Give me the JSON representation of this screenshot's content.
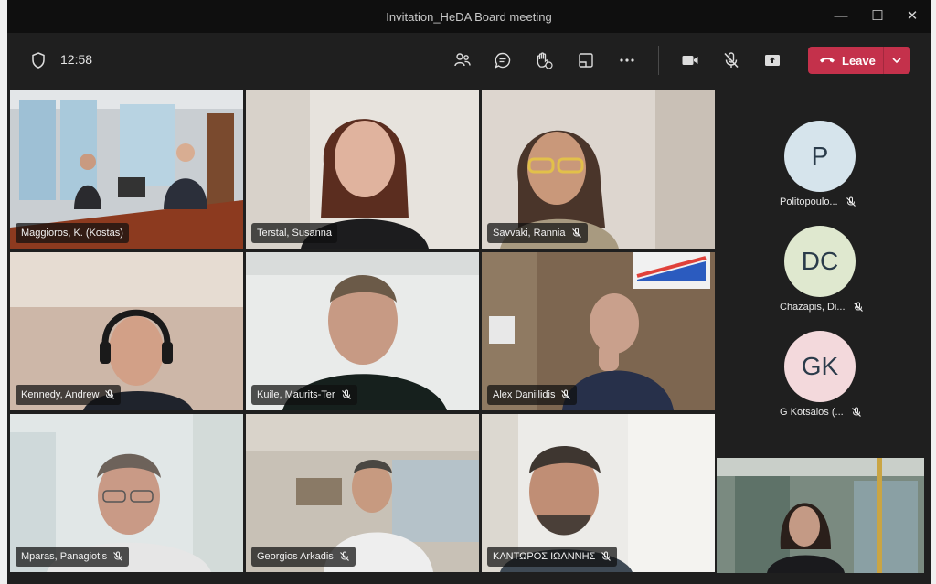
{
  "window": {
    "title": "Invitation_HeDA Board meeting"
  },
  "toolbar": {
    "timer": "12:58",
    "leave_label": "Leave",
    "icons": [
      "shield-icon",
      "people-icon",
      "chat-icon",
      "raise-hand-icon",
      "rooms-icon",
      "more-icon",
      "camera-icon",
      "mic-muted-icon",
      "share-icon"
    ]
  },
  "colors": {
    "leave": "#c4314b",
    "active_border": "#9ea2ff",
    "bg": "#1f1f1f",
    "titlebar": "#0f0f0f"
  },
  "participants": [
    {
      "name": "Maggioros, K. (Kostas)",
      "muted": false,
      "active": true
    },
    {
      "name": "Terstal, Susanna",
      "muted": false
    },
    {
      "name": "Savvaki, Rannia",
      "muted": true
    },
    {
      "name": "Kennedy, Andrew",
      "muted": true
    },
    {
      "name": "Kuile, Maurits-Ter",
      "muted": true
    },
    {
      "name": "Alex Daniilidis",
      "muted": true
    },
    {
      "name": "Mparas, Panagiotis",
      "muted": true
    },
    {
      "name": "Georgios Arkadis",
      "muted": true
    },
    {
      "name": "ΚΑΝΤΩΡΟΣ ΙΩΑΝΝΗΣ",
      "muted": true
    }
  ],
  "side_participants": [
    {
      "initials": "P",
      "name": "Politopoulo...",
      "color": "#d6e4ec",
      "muted": true
    },
    {
      "initials": "DC",
      "name": "Chazapis, Di...",
      "color": "#dfe8cf",
      "muted": true
    },
    {
      "initials": "GK",
      "name": "G Kotsalos (...",
      "color": "#f3d9dc",
      "muted": true
    }
  ]
}
